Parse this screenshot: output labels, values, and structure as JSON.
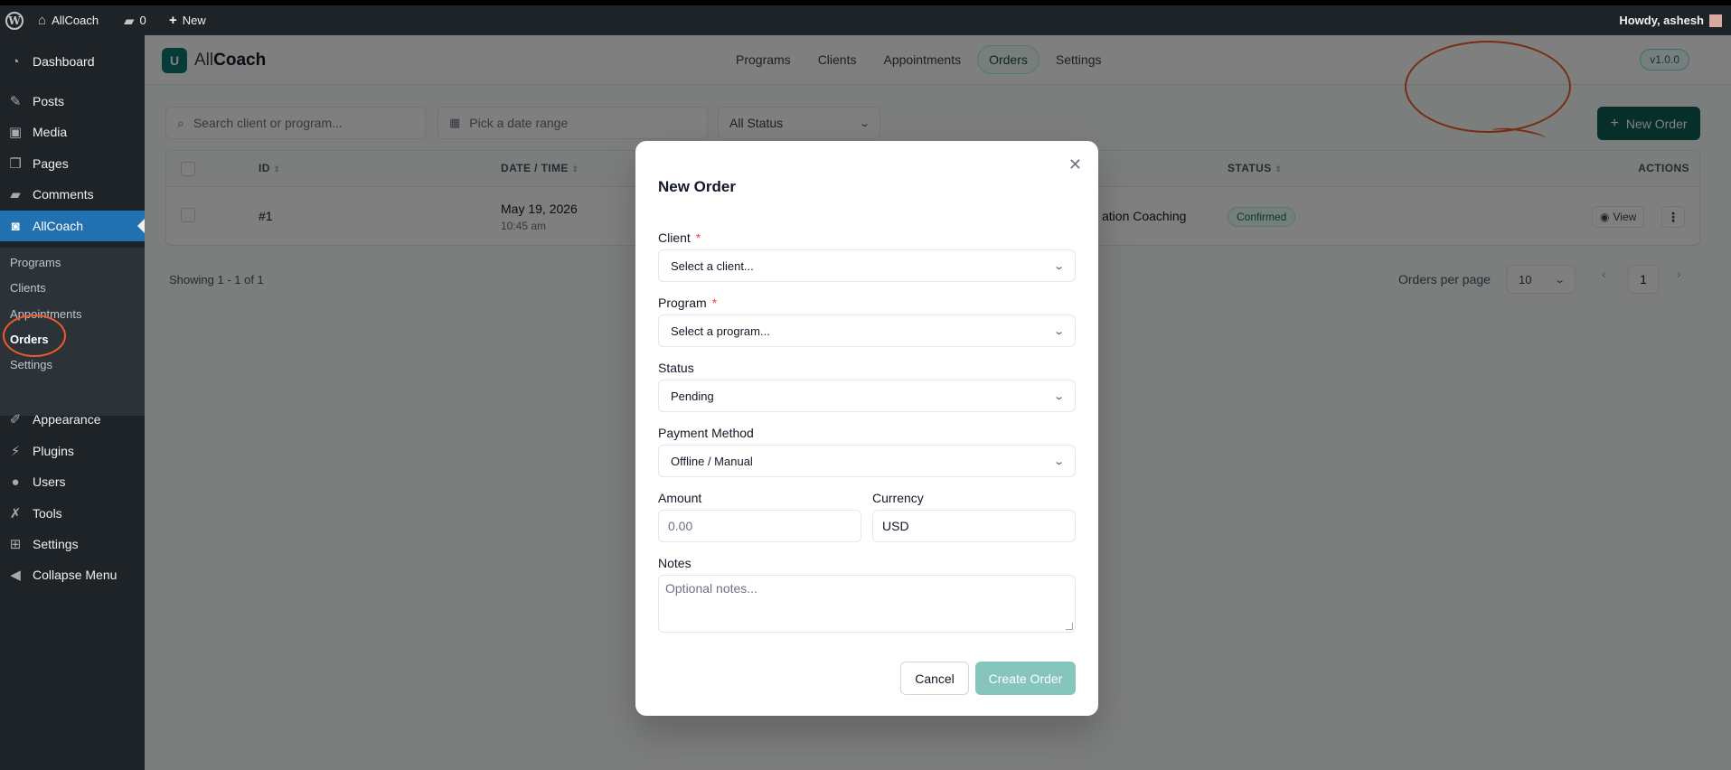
{
  "adminbar": {
    "site_name": "AllCoach",
    "comments_count": "0",
    "new_label": "New",
    "howdy": "Howdy, ashesh"
  },
  "sidebar": {
    "items": [
      {
        "label": "Dashboard",
        "icon": "dashboard-icon"
      },
      {
        "label": "Posts",
        "icon": "pin-icon"
      },
      {
        "label": "Media",
        "icon": "media-icon"
      },
      {
        "label": "Pages",
        "icon": "pages-icon"
      },
      {
        "label": "Comments",
        "icon": "comment-icon"
      },
      {
        "label": "AllCoach",
        "icon": "allcoach-icon"
      },
      {
        "label": "Appearance",
        "icon": "brush-icon"
      },
      {
        "label": "Plugins",
        "icon": "plug-icon"
      },
      {
        "label": "Users",
        "icon": "user-icon"
      },
      {
        "label": "Tools",
        "icon": "wrench-icon"
      },
      {
        "label": "Settings",
        "icon": "settings-icon"
      },
      {
        "label": "Collapse Menu",
        "icon": "collapse-icon"
      }
    ],
    "submenu": [
      "Programs",
      "Clients",
      "Appointments",
      "Orders",
      "Settings"
    ]
  },
  "topnav": {
    "brand_part1": "All",
    "brand_part2": "Coach",
    "tabs": [
      "Programs",
      "Clients",
      "Appointments",
      "Orders",
      "Settings"
    ],
    "active_tab": "Orders",
    "version": "v1.0.0"
  },
  "filters": {
    "search_placeholder": "Search client or program...",
    "date_placeholder": "Pick a date range",
    "status_value": "All Status",
    "new_order_label": "New Order"
  },
  "table": {
    "headers": {
      "id": "ID",
      "datetime": "DATE / TIME",
      "status": "STATUS",
      "actions": "ACTIONS"
    },
    "rows": [
      {
        "id": "#1",
        "date": "May 19, 2026",
        "time": "10:45 am",
        "program_partial": "ation Coaching",
        "status": "Confirmed",
        "view_label": "View"
      }
    ]
  },
  "pagination": {
    "showing": "Showing 1 - 1 of 1",
    "per_page_label": "Orders per page",
    "per_page_value": "10",
    "current_page": "1"
  },
  "modal": {
    "title": "New Order",
    "client_label": "Client",
    "client_placeholder": "Select a client...",
    "program_label": "Program",
    "program_placeholder": "Select a program...",
    "status_label": "Status",
    "status_value": "Pending",
    "payment_label": "Payment Method",
    "payment_value": "Offline / Manual",
    "amount_label": "Amount",
    "amount_placeholder": "0.00",
    "currency_label": "Currency",
    "currency_value": "USD",
    "notes_label": "Notes",
    "notes_placeholder": "Optional notes...",
    "cancel_label": "Cancel",
    "create_label": "Create Order",
    "required_mark": "*"
  },
  "colors": {
    "wp_admin_bg": "#1d2327",
    "wp_active": "#2271b1",
    "brand_teal": "#0f5f55",
    "annotation": "#ef5a2a"
  }
}
